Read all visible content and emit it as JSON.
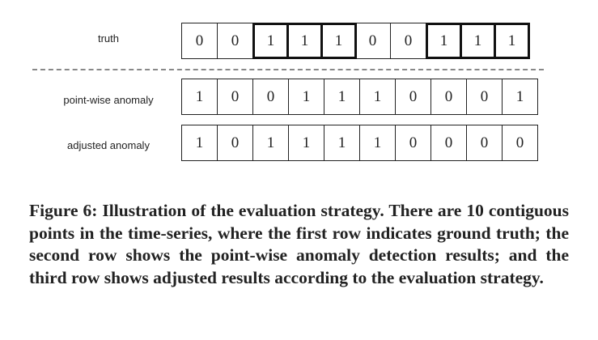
{
  "rows": [
    {
      "label": "truth",
      "values": [
        "0",
        "0",
        "1",
        "1",
        "1",
        "0",
        "0",
        "1",
        "1",
        "1"
      ],
      "highlight": [
        false,
        false,
        true,
        true,
        true,
        false,
        false,
        true,
        true,
        true
      ]
    },
    {
      "label": "point-wise anomaly",
      "values": [
        "1",
        "0",
        "0",
        "1",
        "1",
        "1",
        "0",
        "0",
        "0",
        "1"
      ]
    },
    {
      "label": "adjusted anomaly",
      "values": [
        "1",
        "0",
        "1",
        "1",
        "1",
        "1",
        "0",
        "0",
        "0",
        "0"
      ]
    }
  ],
  "caption": "Figure 6: Illustration of the evaluation strategy. There are 10 contiguous points in the time-series, where the first row indicates ground truth; the second row shows the point-wise anomaly detection results; and the third row shows adjusted results according to the evaluation strategy."
}
